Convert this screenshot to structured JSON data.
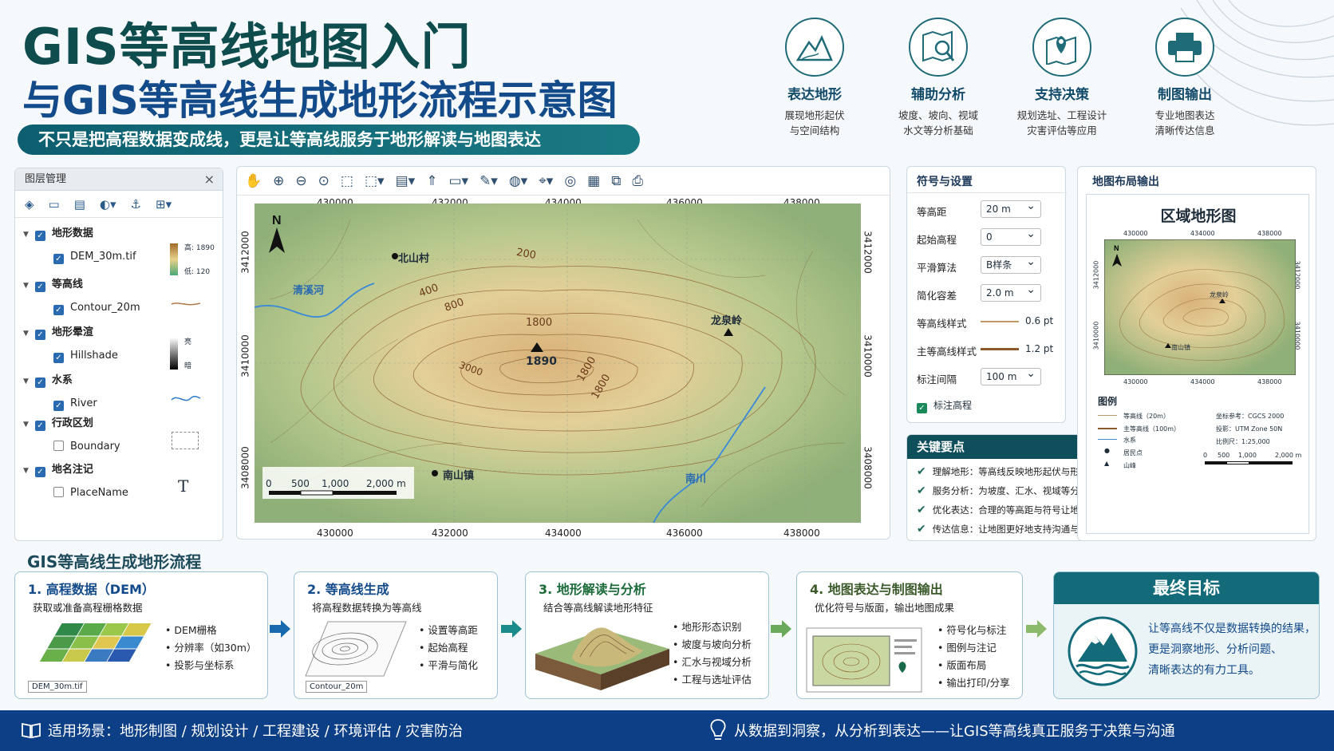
{
  "header": {
    "title_line1": "GIS等高线地图入门",
    "title_line2": "与GIS等高线生成地形流程示意图",
    "subtitle": "不只是把高程数据变成线，更是让等高线服务于地形解读与地图表达"
  },
  "features": [
    {
      "icon": "mountain-icon",
      "title": "表达地形",
      "desc1": "展现地形起伏",
      "desc2": "与空间结构"
    },
    {
      "icon": "map-magnifier-icon",
      "title": "辅助分析",
      "desc1": "坡度、坡向、视域",
      "desc2": "水文等分析基础"
    },
    {
      "icon": "map-pin-icon",
      "title": "支持决策",
      "desc1": "规划选址、工程设计",
      "desc2": "灾害评估等应用"
    },
    {
      "icon": "printer-icon",
      "title": "制图输出",
      "desc1": "专业地图表达",
      "desc2": "清晰传达信息"
    }
  ],
  "layers_panel": {
    "title": "图层管理",
    "close": "×",
    "groups": [
      {
        "name": "地形数据",
        "item": "DEM_30m.tif",
        "checked": true,
        "legend_hi": "高: 1890",
        "legend_lo": "低: 120"
      },
      {
        "name": "等高线",
        "item": "Contour_20m",
        "checked": true
      },
      {
        "name": "地形晕渲",
        "item": "Hillshade",
        "checked": true,
        "legend_hi": "亮",
        "legend_lo": "暗"
      },
      {
        "name": "水系",
        "item": "River",
        "checked": true
      },
      {
        "name": "行政区划",
        "item": "Boundary",
        "checked": false
      },
      {
        "name": "地名注记",
        "item": "PlaceName",
        "checked": false,
        "legend_glyph": "T"
      }
    ]
  },
  "map": {
    "x_ticks": [
      "430000",
      "432000",
      "434000",
      "436000",
      "438000"
    ],
    "y_ticks": [
      "3412000",
      "3410000",
      "3408000"
    ],
    "north": "N",
    "places": [
      "北山村",
      "龙泉岭",
      "南山镇"
    ],
    "rivers": [
      "清溪河",
      "南川"
    ],
    "peak_label": "1890",
    "contour_labels": [
      "200",
      "400",
      "800",
      "1800",
      "1800",
      "1800",
      "3000"
    ],
    "scale_labels": [
      "0",
      "500",
      "1,000",
      "2,000 m"
    ]
  },
  "settings": {
    "title": "符号与设置",
    "rows": [
      {
        "label": "等高距",
        "value": "20 m"
      },
      {
        "label": "起始高程",
        "value": "0"
      },
      {
        "label": "平滑算法",
        "value": "B样条"
      },
      {
        "label": "简化容差",
        "value": "2.0 m"
      },
      {
        "label": "等高线样式",
        "value": "0.6 pt"
      },
      {
        "label": "主等高线样式",
        "value": "1.2 pt"
      },
      {
        "label": "标注间隔",
        "value": "100 m"
      }
    ],
    "checkbox_label": "标注高程"
  },
  "keypoints": {
    "title": "关键要点",
    "items": [
      "理解地形：等高线反映地形起伏与形态特征",
      "服务分析：为坡度、汇水、视域等分析提供基础",
      "优化表达：合理的等高距与符号让地图更清晰易读",
      "传达信息：让地图更好地支持沟通与决策"
    ]
  },
  "layout_panel": {
    "title": "地图布局输出",
    "map_title": "区域地形图",
    "x_ticks": [
      "430000",
      "434000",
      "438000"
    ],
    "y_ticks": [
      "3412000",
      "3410000"
    ],
    "places": [
      "龙泉岭",
      "南山镇"
    ],
    "legend_title": "图例",
    "legend_items": [
      "等高线（20m）",
      "主等高线（100m）",
      "水系",
      "居民点",
      "山峰"
    ],
    "info": [
      "坐标参考：CGCS 2000",
      "投影：UTM Zone 50N",
      "比例尺：1:25,000"
    ],
    "scale": [
      "0",
      "500",
      "1,000",
      "2,000 m"
    ]
  },
  "flow": {
    "title": "GIS等高线生成地形流程",
    "steps": [
      {
        "title": "1. 高程数据（DEM）",
        "desc": "获取或准备高程栅格数据",
        "bullets": [
          "DEM栅格",
          "分辨率（如30m）",
          "投影与坐标系"
        ],
        "file": "DEM_30m.tif"
      },
      {
        "title": "2. 等高线生成",
        "desc": "将高程数据转换为等高线",
        "bullets": [
          "设置等高距",
          "起始高程",
          "平滑与简化"
        ],
        "file": "Contour_20m"
      },
      {
        "title": "3. 地形解读与分析",
        "desc": "结合等高线解读地形特征",
        "bullets": [
          "地形形态识别",
          "坡度与坡向分析",
          "汇水与视域分析",
          "工程与选址评估"
        ]
      },
      {
        "title": "4. 地图表达与制图输出",
        "desc": "优化符号与版面，输出地图成果",
        "bullets": [
          "符号化与标注",
          "图例与注记",
          "版面布局",
          "输出打印/分享"
        ]
      }
    ],
    "goal_title": "最终目标",
    "goal_lines": [
      "让等高线不仅是数据转换的结果，",
      "更是洞察地形、分析问题、",
      "清晰表达的有力工具。"
    ]
  },
  "footer": {
    "left": "适用场景：地形制图 / 规划设计 / 工程建设 / 环境评估 / 灾害防治",
    "right": "从数据到洞察，从分析到表达——让GIS等高线真正服务于决策与沟通"
  },
  "colors": {
    "teal": "#0f4f5c",
    "navy": "#0d3f86",
    "title_blue": "#124a8a",
    "contour": "#8a5a2a"
  }
}
